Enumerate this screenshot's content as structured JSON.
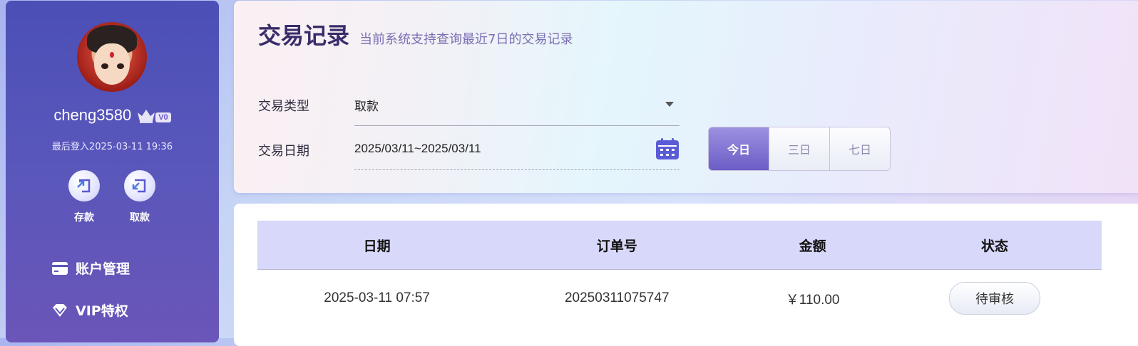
{
  "sidebar": {
    "username": "cheng3580",
    "vip_level": "V0",
    "last_login": "最后登入2025-03-11 19:36",
    "quick_actions": [
      {
        "label": "存款",
        "icon": "deposit-icon"
      },
      {
        "label": "取款",
        "icon": "withdraw-icon"
      }
    ],
    "nav": [
      {
        "label": "账户管理",
        "icon": "card-icon"
      },
      {
        "label": "VIP特权",
        "icon": "diamond-icon"
      }
    ]
  },
  "filter": {
    "title": "交易记录",
    "subtitle": "当前系统支持查询最近7日的交易记录",
    "type_label": "交易类型",
    "type_value": "取款",
    "date_label": "交易日期",
    "date_value": "2025/03/11~2025/03/11",
    "ranges": [
      {
        "label": "今日",
        "active": true
      },
      {
        "label": "三日",
        "active": false
      },
      {
        "label": "七日",
        "active": false
      }
    ]
  },
  "table": {
    "columns": [
      "日期",
      "订单号",
      "金额",
      "状态"
    ],
    "rows": [
      {
        "date": "2025-03-11 07:57",
        "order": "20250311075747",
        "amount": "￥110.00",
        "status": "待审核"
      }
    ]
  },
  "colors": {
    "sidebar_top": "#4b4fb6",
    "sidebar_bottom": "#6b55b8",
    "accent": "#6b5dc6",
    "table_header": "#d8d8fa"
  }
}
